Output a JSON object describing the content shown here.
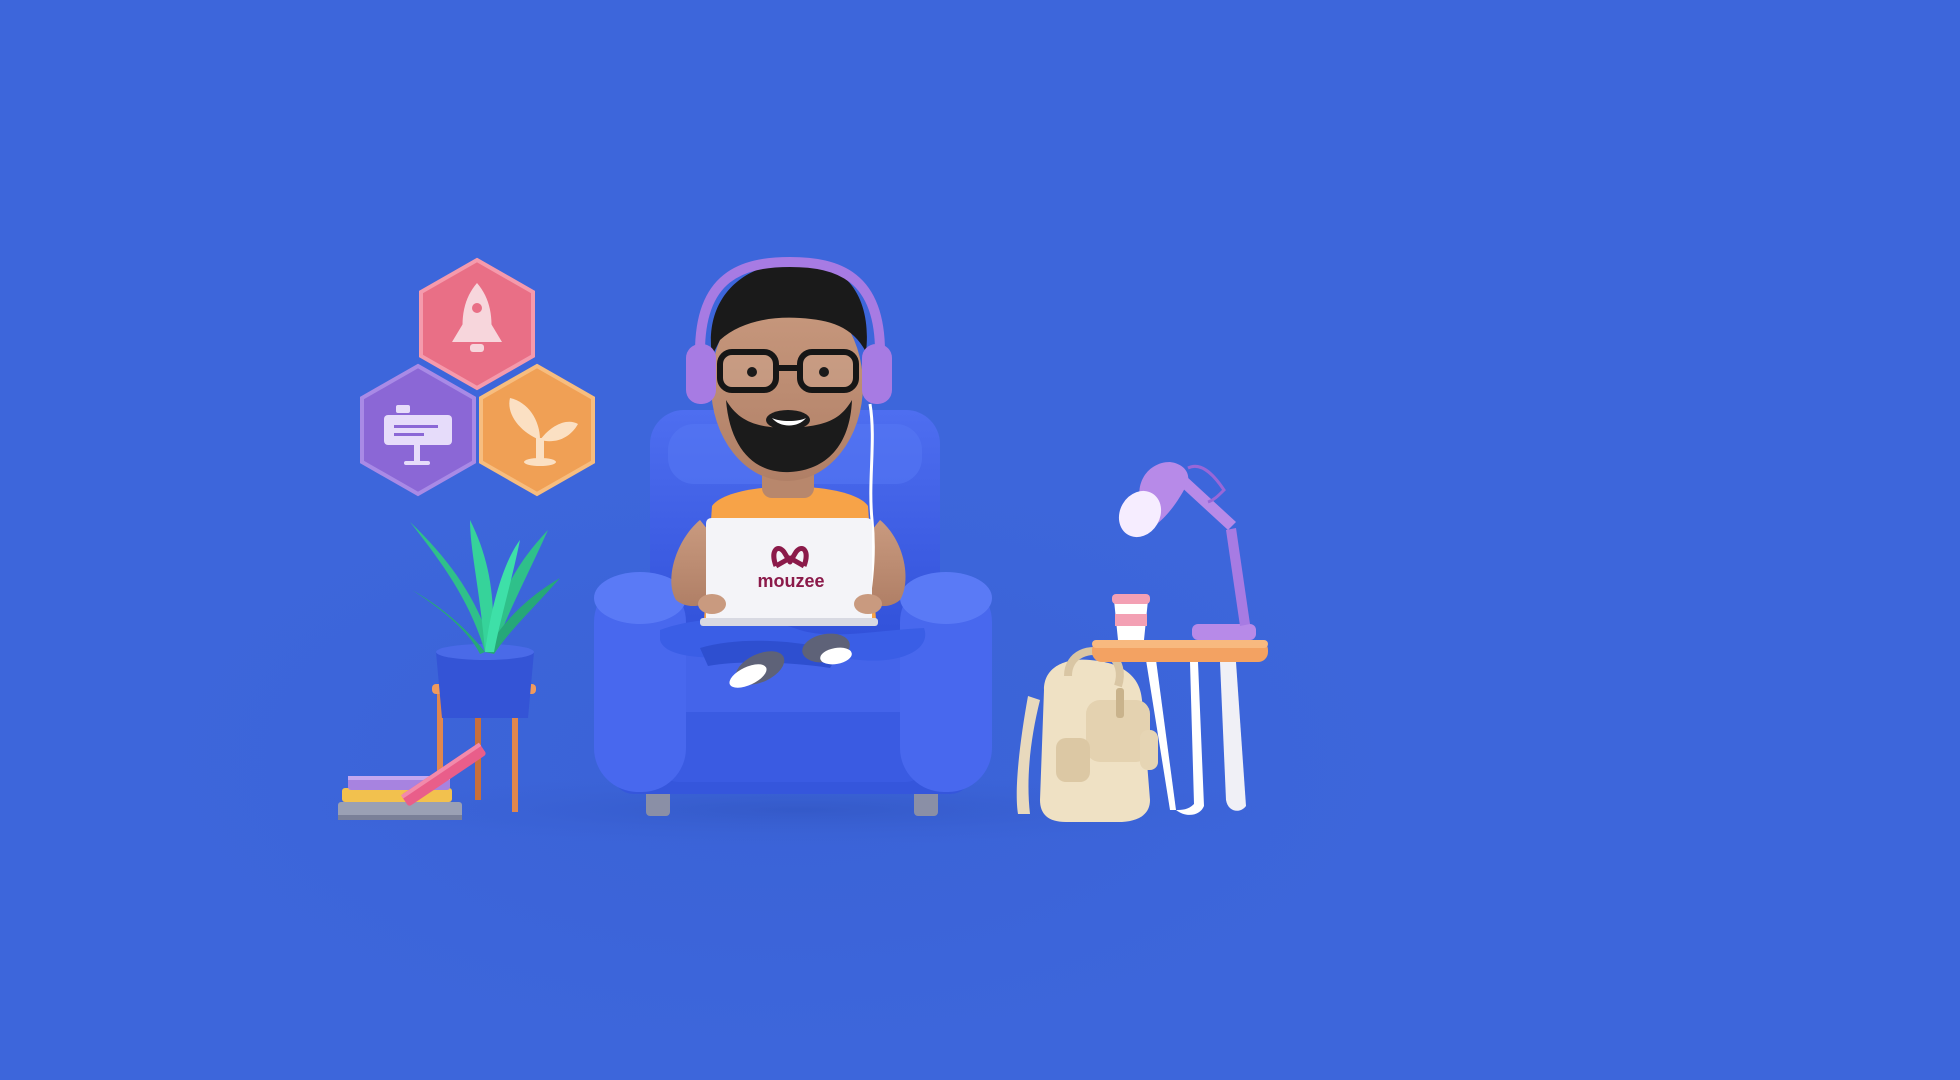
{
  "background_color": "#3d66db",
  "laptop": {
    "brand_text": "mouzee",
    "brand_color": "#8b1a4a"
  },
  "badges": [
    {
      "name": "rocket",
      "color": "#e96f86",
      "icon": "rocket-icon"
    },
    {
      "name": "presentation",
      "color": "#8b67d6",
      "icon": "presentation-board-icon"
    },
    {
      "name": "growth",
      "color": "#f0a055",
      "icon": "sprout-icon"
    }
  ]
}
